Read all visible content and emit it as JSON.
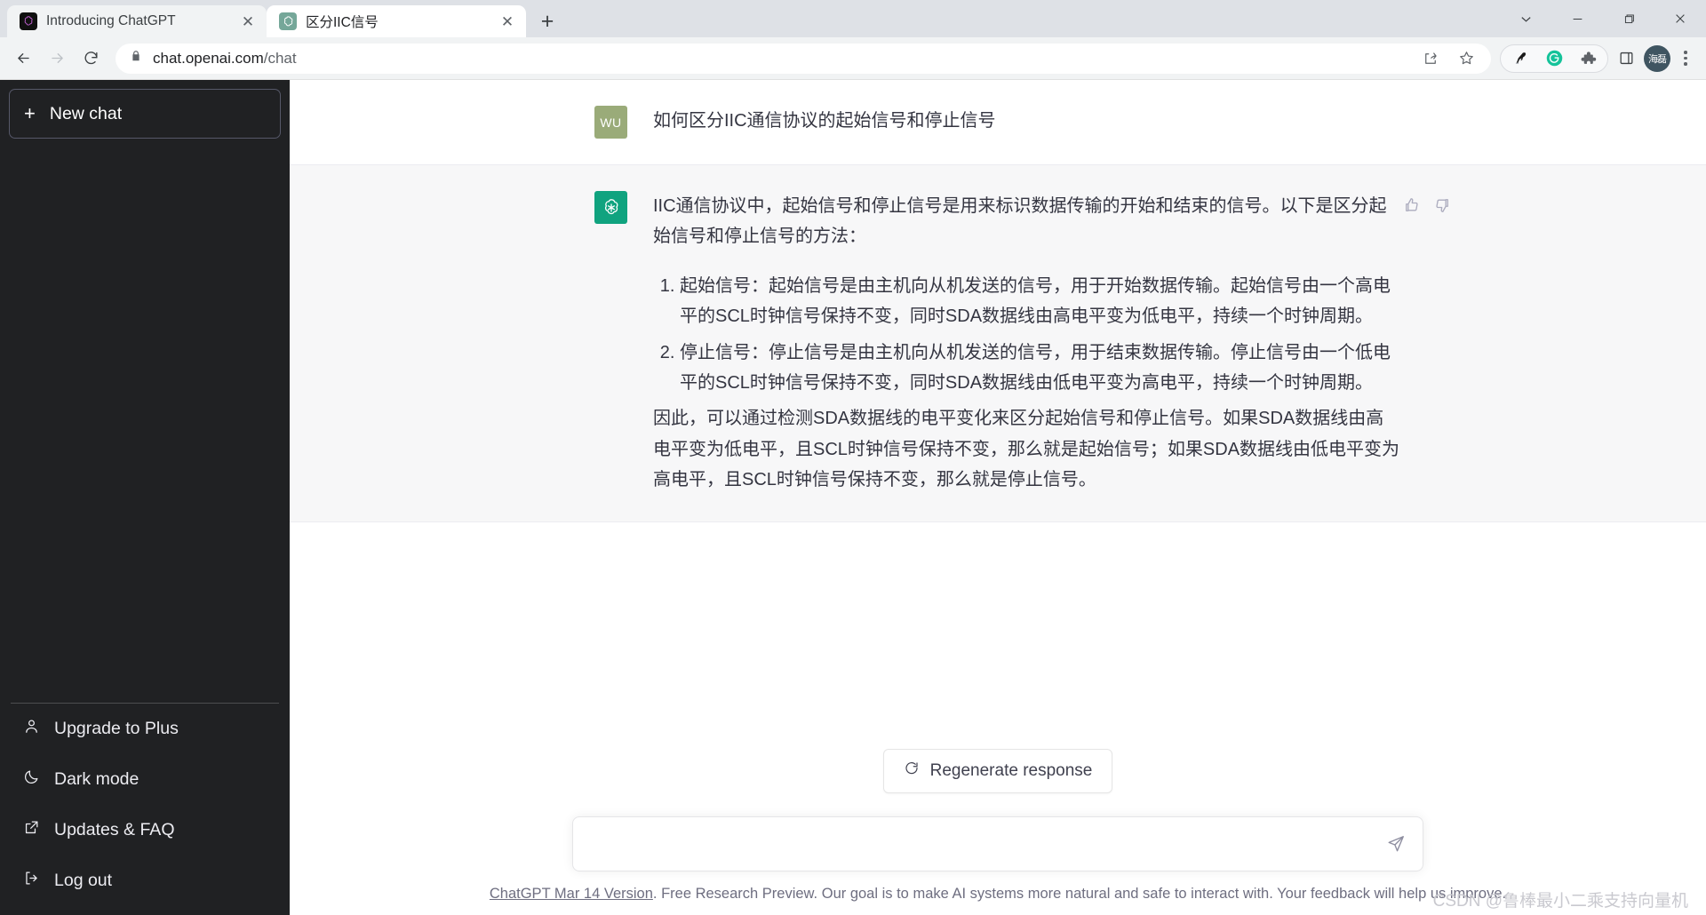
{
  "browser": {
    "tabs": [
      {
        "title": "Introducing ChatGPT",
        "favicon": "openai-logo-dark",
        "active": false,
        "close_label": "✕"
      },
      {
        "title": "区分IIC信号",
        "favicon": "openai-logo-green",
        "active": true,
        "close_label": "✕"
      }
    ],
    "new_tab_label": "+",
    "window_controls": {
      "collapse": "⌄",
      "minimize": "–",
      "maximize": "❐",
      "close": "✕"
    },
    "omnibox": {
      "host": "chat.openai.com",
      "path": "/chat",
      "placeholder": "Search Google or type a URL",
      "lock_icon": "lock-icon"
    },
    "toolbar_icons": {
      "back": "back-arrow-icon",
      "forward": "forward-arrow-icon",
      "reload": "reload-icon",
      "share": "share-icon",
      "bookmark": "star-icon",
      "ext_bird": "bird-extension-icon",
      "ext_grammarly": "grammarly-icon",
      "ext_puzzle": "extensions-puzzle-icon",
      "side_panel": "side-panel-icon",
      "profile_initials": "海磊",
      "menu": "three-dot-menu-icon"
    }
  },
  "sidebar": {
    "new_chat": {
      "label": "New chat",
      "icon": "plus-icon"
    },
    "items": [
      {
        "label": "Upgrade to Plus",
        "icon": "user-icon"
      },
      {
        "label": "Dark mode",
        "icon": "moon-icon"
      },
      {
        "label": "Updates & FAQ",
        "icon": "external-link-icon"
      },
      {
        "label": "Log out",
        "icon": "logout-icon"
      }
    ]
  },
  "conversation": {
    "messages": [
      {
        "role": "user",
        "avatar_initials": "WU",
        "avatar_color": "#9aab79",
        "text": "如何区分IIC通信协议的起始信号和停止信号"
      },
      {
        "role": "assistant",
        "avatar_icon": "openai-logo-icon",
        "avatar_color": "#10a37f",
        "intro": "IIC通信协议中，起始信号和停止信号是用来标识数据传输的开始和结束的信号。以下是区分起始信号和停止信号的方法：",
        "list": [
          "起始信号：起始信号是由主机向从机发送的信号，用于开始数据传输。起始信号由一个高电平的SCL时钟信号保持不变，同时SDA数据线由高电平变为低电平，持续一个时钟周期。",
          "停止信号：停止信号是由主机向从机发送的信号，用于结束数据传输。停止信号由一个低电平的SCL时钟信号保持不变，同时SDA数据线由低电平变为高电平，持续一个时钟周期。"
        ],
        "outro": "因此，可以通过检测SDA数据线的电平变化来区分起始信号和停止信号。如果SDA数据线由高电平变为低电平，且SCL时钟信号保持不变，那么就是起始信号；如果SDA数据线由低电平变为高电平，且SCL时钟信号保持不变，那么就是停止信号。",
        "feedback": {
          "up": "thumbs-up-icon",
          "down": "thumbs-down-icon"
        }
      }
    ]
  },
  "composer": {
    "regenerate_label": "Regenerate response",
    "regenerate_icon": "refresh-icon",
    "input_value": "",
    "input_placeholder": "",
    "send_icon": "send-icon"
  },
  "footer": {
    "link_label": "ChatGPT Mar 14 Version",
    "rest": ". Free Research Preview. Our goal is to make AI systems more natural and safe to interact with. Your feedback will help us improve."
  },
  "watermark": {
    "text": "CSDN @鲁棒最小二乘支持向量机"
  },
  "colors": {
    "brand_green": "#10a37f",
    "sidebar_bg": "#202123",
    "assistant_bg": "#f7f7f8",
    "text": "#343541"
  }
}
